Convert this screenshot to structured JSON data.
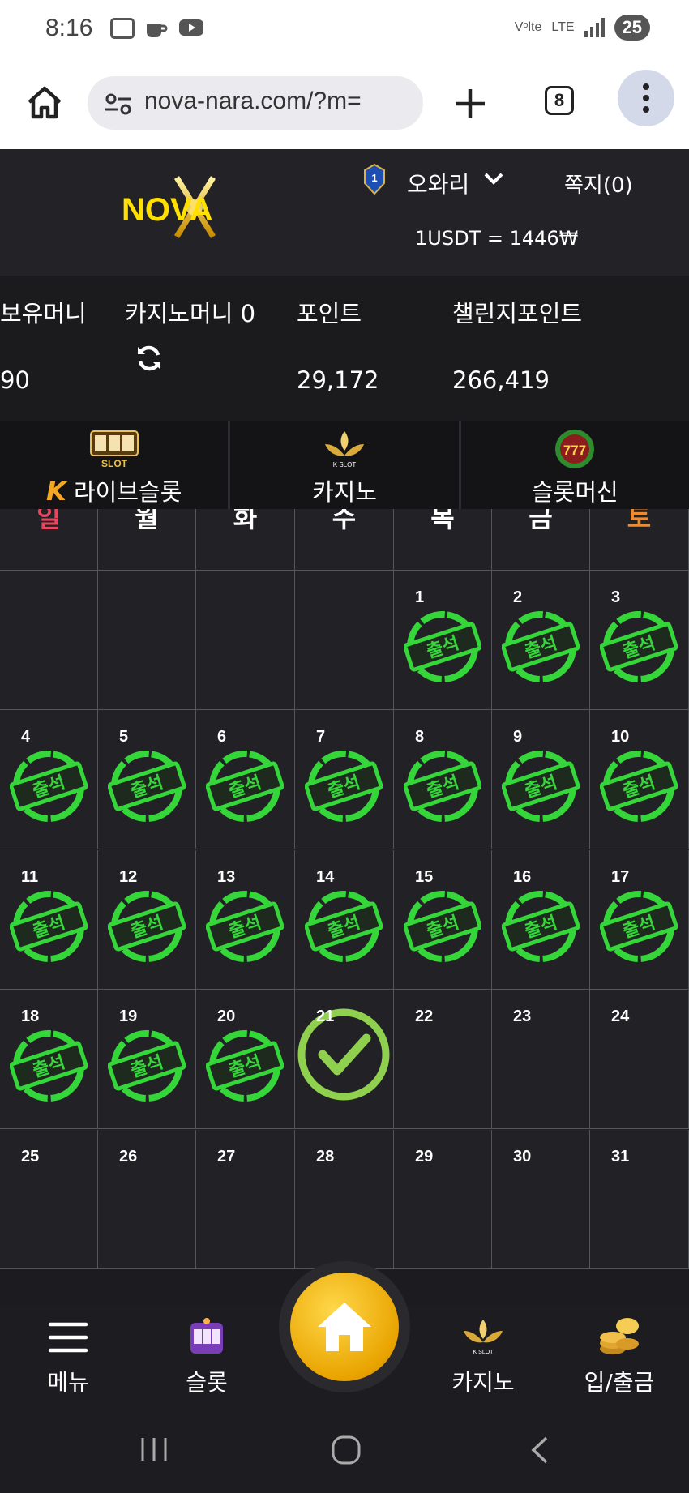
{
  "status_bar": {
    "time": "8:16",
    "network": "LTE",
    "volte": "Vᵒlte",
    "battery": "25"
  },
  "browser": {
    "url": "nova-nara.com/?m=",
    "tab_count": "8"
  },
  "header": {
    "logo_text": "NOVA",
    "rank_level": "1",
    "username": "오와리",
    "memo_label": "쪽지(0)",
    "rate_text": "1USDT = 1446₩"
  },
  "balances": {
    "holding_label": "보유머니",
    "holding_value": "90",
    "casino_label": "카지노머니 0",
    "point_label": "포인트",
    "point_value": "29,172",
    "challenge_label": "챌린지포인트",
    "challenge_value": "266,419"
  },
  "game_tabs": [
    {
      "label": "라이브슬롯",
      "icon": "live-slot-icon",
      "badge": "K",
      "icon_text": "LIVE SLOT"
    },
    {
      "label": "카지노",
      "icon": "k-slot-icon",
      "icon_text": "K SLOT"
    },
    {
      "label": "슬롯머신",
      "icon": "777-slots-icon",
      "icon_text": "777"
    }
  ],
  "calendar": {
    "weekdays": [
      "일",
      "월",
      "화",
      "수",
      "목",
      "금",
      "토"
    ],
    "weekday_colors": [
      "#e8455f",
      "#ffffff",
      "#ffffff",
      "#ffffff",
      "#ffffff",
      "#ffffff",
      "#f08a2a"
    ],
    "stamp_text": "출석",
    "stamp_color": "#35d63a",
    "today": 21,
    "weeks": [
      [
        null,
        null,
        null,
        null,
        1,
        2,
        3
      ],
      [
        4,
        5,
        6,
        7,
        8,
        9,
        10
      ],
      [
        11,
        12,
        13,
        14,
        15,
        16,
        17
      ],
      [
        18,
        19,
        20,
        21,
        22,
        23,
        24
      ],
      [
        25,
        26,
        27,
        28,
        29,
        30,
        31
      ]
    ],
    "attended": [
      1,
      2,
      3,
      4,
      5,
      6,
      7,
      8,
      9,
      10,
      11,
      12,
      13,
      14,
      15,
      16,
      17,
      18,
      19,
      20
    ]
  },
  "bottom_nav": {
    "menu": "메뉴",
    "slot": "슬롯",
    "casino": "카지노",
    "deposit": "입/출금"
  }
}
